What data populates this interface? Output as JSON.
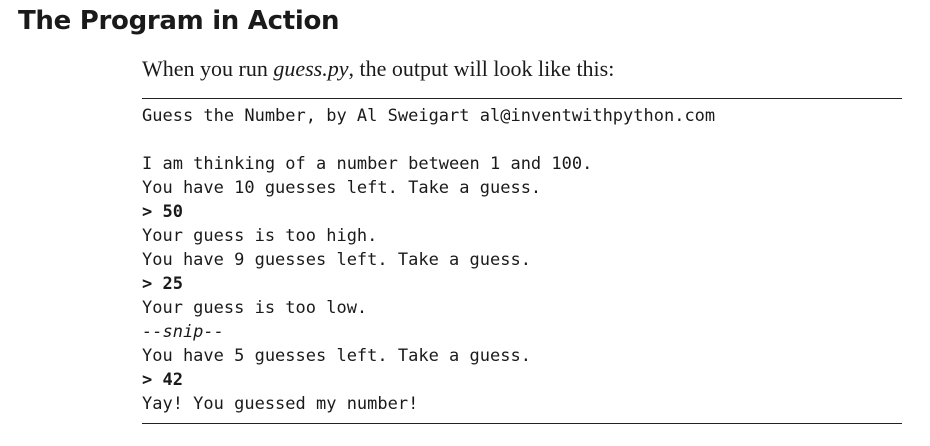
{
  "section": {
    "heading": "The Program in Action"
  },
  "intro": {
    "before": "When you run ",
    "filename": "guess.py",
    "after": ", the output will look like this:"
  },
  "output": {
    "lines": [
      "Guess the Number, by Al Sweigart al@inventwithpython.com",
      "",
      "I am thinking of a number between 1 and 100.",
      "You have 10 guesses left. Take a guess.",
      "> 50",
      "Your guess is too high.",
      "You have 9 guesses left. Take a guess.",
      "> 25",
      "Your guess is too low.",
      "--snip--",
      "You have 5 guesses left. Take a guess.",
      "> 42",
      "Yay! You guessed my number!"
    ]
  }
}
